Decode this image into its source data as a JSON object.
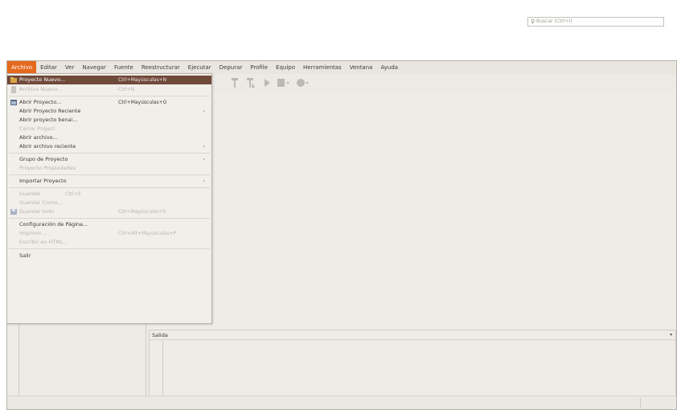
{
  "menubar": {
    "items": [
      "Archivo",
      "Editar",
      "Ver",
      "Navegar",
      "Fuente",
      "Reestructurar",
      "Ejecutar",
      "Depurar",
      "Profile",
      "Equipo",
      "Herramientas",
      "Ventana",
      "Ayuda"
    ],
    "active_index": 0
  },
  "toolbar": {
    "search_placeholder": "Buscar (Ctrl+I)"
  },
  "file_menu": {
    "items": [
      {
        "label": "Proyecto Nuevo...",
        "shortcut": "Ctrl+Mayúsculas+N",
        "state": "highlight",
        "icon": "new-project-icon"
      },
      {
        "label": "Archivo Nuevo...",
        "shortcut": "Ctrl+N",
        "state": "disabled",
        "icon": "new-file-icon"
      },
      {
        "label": "Abrir Proyecto...",
        "shortcut": "Ctrl+Mayúsculas+O",
        "state": "normal",
        "icon": "open-project-icon"
      },
      {
        "label": "Abrir Proyecto Reciente",
        "shortcut": "",
        "state": "normal",
        "submenu": true
      },
      {
        "label": "Abrir proyecto benai...",
        "shortcut": "",
        "state": "normal"
      },
      {
        "label": "Cerrar Project",
        "shortcut": "",
        "state": "disabled"
      },
      {
        "label": "Abrir archivo...",
        "shortcut": "",
        "state": "normal"
      },
      {
        "label": "Abrir archivo reciente",
        "shortcut": "",
        "state": "normal",
        "submenu": true
      },
      {
        "label": "Grupo de Proyecto",
        "shortcut": "",
        "state": "normal",
        "submenu": true
      },
      {
        "label": "Proyecto Propiedades",
        "shortcut": "",
        "state": "disabled"
      },
      {
        "label": "Importar Proyecto",
        "shortcut": "",
        "state": "normal",
        "submenu": true
      },
      {
        "label": "Guardar",
        "shortcut": "Ctrl+S",
        "state": "disabled"
      },
      {
        "label": "Guardar Como...",
        "shortcut": "",
        "state": "disabled"
      },
      {
        "label": "Guardar todo",
        "shortcut": "Ctrl+Mayúsculas+S",
        "state": "disabled",
        "icon": "save-all-icon"
      },
      {
        "label": "Configuración de Página...",
        "shortcut": "",
        "state": "normal"
      },
      {
        "label": "Imprimir...",
        "shortcut": "Ctrl+Alt+Mayúsculas+P",
        "state": "disabled"
      },
      {
        "label": "Escribir en HTML...",
        "shortcut": "",
        "state": "disabled"
      },
      {
        "label": "Salir",
        "shortcut": "",
        "state": "normal"
      }
    ],
    "submenu_arrow": "›"
  },
  "output_panel": {
    "title": "Salida",
    "arrow": "▾"
  },
  "colors": {
    "menu_active": "#e5691d",
    "menu_item_highlight": "#6f4a3a"
  }
}
